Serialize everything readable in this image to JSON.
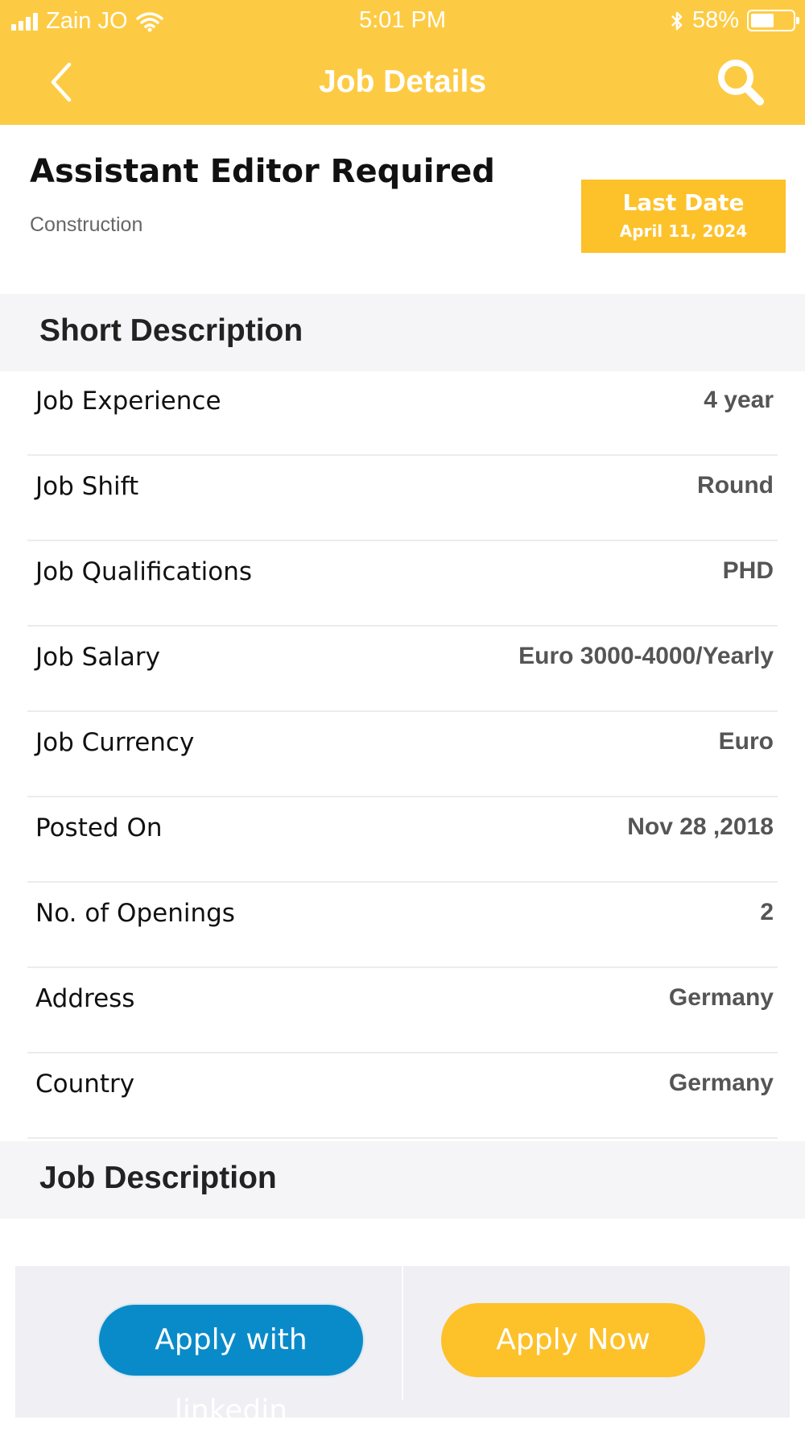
{
  "status_bar": {
    "carrier": "Zain JO",
    "time": "5:01 PM",
    "battery_percent": "58%",
    "battery_level": 0.58
  },
  "nav": {
    "title": "Job Details",
    "back_icon": "chevron-left-icon",
    "search_icon": "search-icon"
  },
  "job": {
    "title": "Assistant Editor Required",
    "category": "Construction",
    "last_date_label": "Last Date",
    "last_date_value": "April 11, 2024"
  },
  "sections": {
    "short_description": "Short Description",
    "job_description": "Job Description"
  },
  "details": [
    {
      "label": "Job Experience",
      "value": "4 year"
    },
    {
      "label": "Job Shift",
      "value": "Round"
    },
    {
      "label": "Job Qualifications",
      "value": "PHD"
    },
    {
      "label": "Job Salary",
      "value": "Euro 3000-4000/Yearly"
    },
    {
      "label": "Job Currency",
      "value": "Euro"
    },
    {
      "label": "Posted On",
      "value": "Nov 28 ,2018"
    },
    {
      "label": "No. of Openings",
      "value": "2"
    },
    {
      "label": "Address",
      "value": "Germany"
    },
    {
      "label": "Country",
      "value": "Germany"
    }
  ],
  "actions": {
    "linkedin_label": "Apply with linkedin",
    "apply_label": "Apply Now"
  },
  "colors": {
    "header": "#FDCB43",
    "accent_yellow": "#FDC12A",
    "linkedin_blue": "#0A8BC9"
  }
}
